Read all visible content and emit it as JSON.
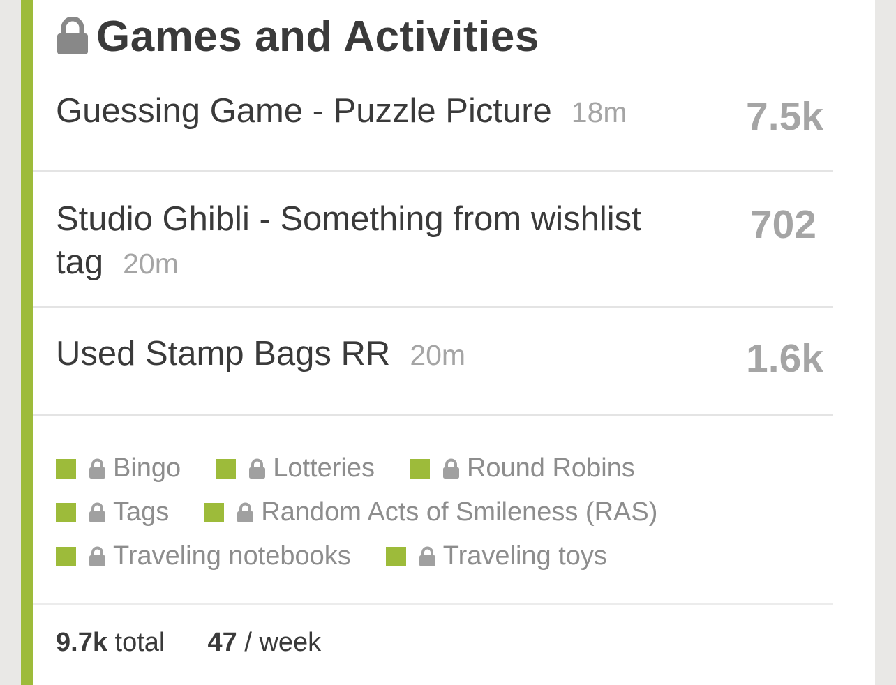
{
  "section": {
    "title": "Games and Activities",
    "lock_icon": "lock-icon"
  },
  "threads": [
    {
      "title": "Guessing Game - Puzzle Picture",
      "age": "18m",
      "count": "7.5k"
    },
    {
      "title": "Studio Ghibli - Something from wishlist tag",
      "age": "20m",
      "count": "702"
    },
    {
      "title": "Used Stamp Bags RR",
      "age": "20m",
      "count": "1.6k"
    }
  ],
  "categories": [
    {
      "label": "Bingo"
    },
    {
      "label": "Lotteries"
    },
    {
      "label": "Round Robins"
    },
    {
      "label": "Tags"
    },
    {
      "label": "Random Acts of Smileness (RAS)"
    },
    {
      "label": "Traveling notebooks"
    },
    {
      "label": "Traveling toys"
    }
  ],
  "footer": {
    "total_value": "9.7k",
    "total_label": "total",
    "weekly_value": "47",
    "weekly_label": "/ week"
  },
  "colors": {
    "accent": "#9dbb3a",
    "muted_text": "#a5a5a5",
    "primary_text": "#3a3a3a"
  }
}
